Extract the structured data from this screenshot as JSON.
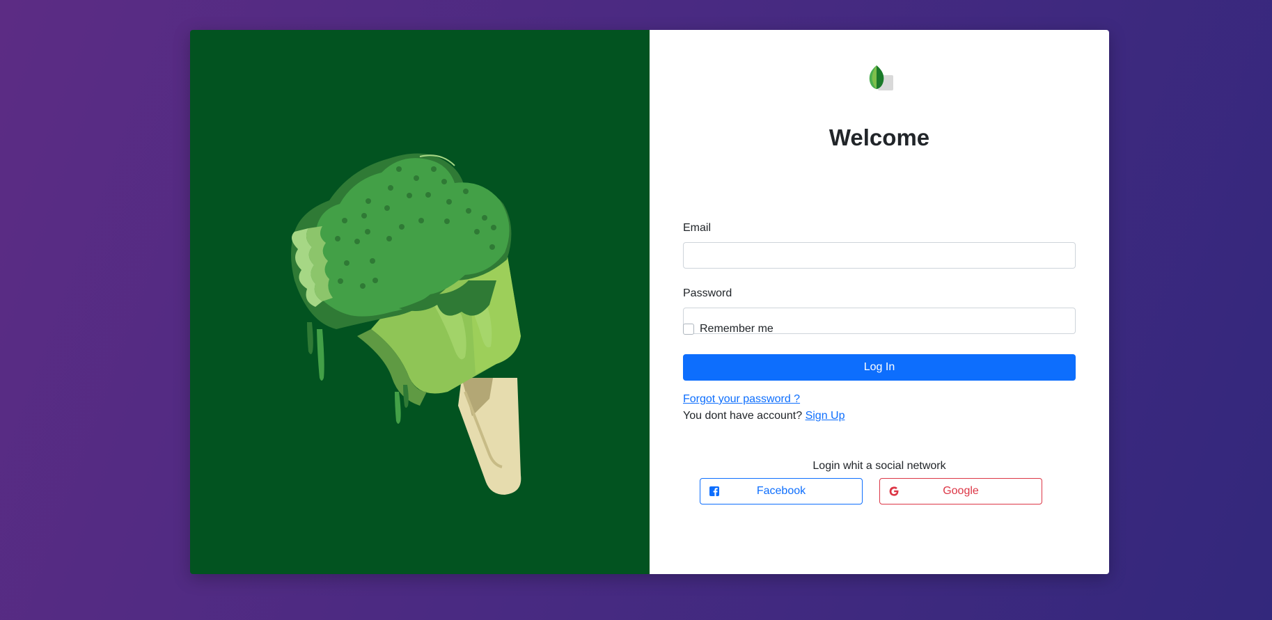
{
  "login": {
    "title": "Welcome",
    "email_label": "Email",
    "email_value": "",
    "password_label": "Password",
    "password_value": "",
    "remember_label": "Remember me",
    "remember_checked": false,
    "login_button": "Log In",
    "forgot_link": "Forgot your password ?",
    "no_account_text": "You dont have account?",
    "signup_link": "Sign Up"
  },
  "social": {
    "heading": "Login whit a social network",
    "facebook_label": "Facebook",
    "facebook_icon": "facebook-square-icon",
    "google_label": "Google",
    "google_icon": "google-icon"
  },
  "colors": {
    "background_start": "#5c2c84",
    "background_end": "#33287c",
    "hero_background": "#025320",
    "primary": "#0d6efd",
    "danger": "#dc3545"
  },
  "images": {
    "hero": "broccoli-popsicle-illustration",
    "logo": "leaf-logo"
  }
}
